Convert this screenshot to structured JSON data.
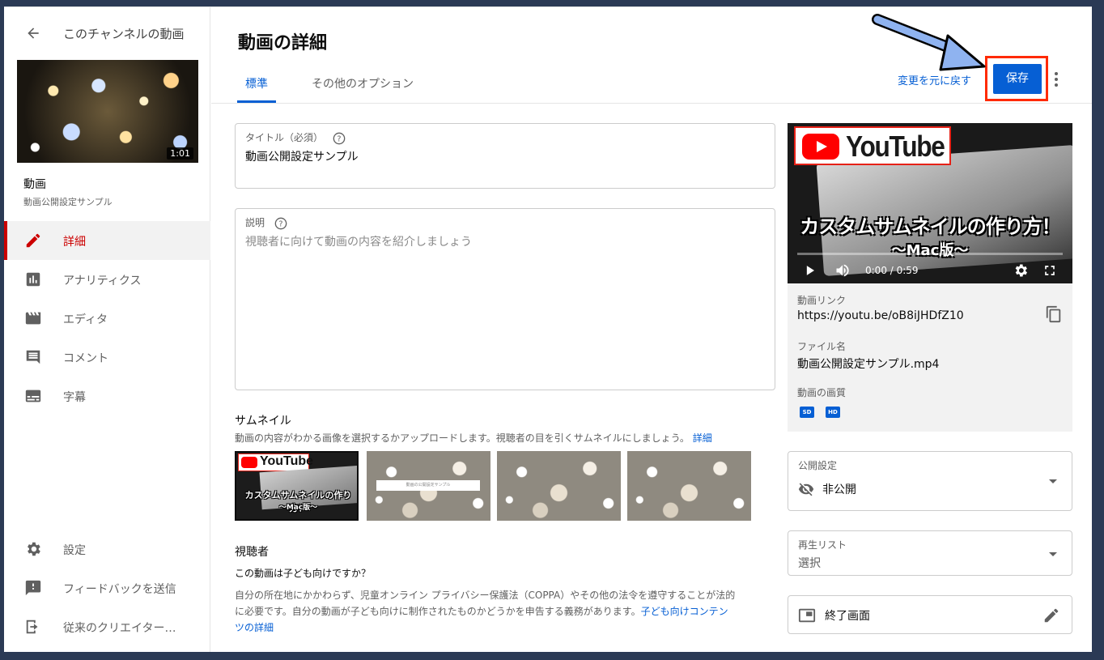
{
  "sidebar": {
    "back_title": "このチャンネルの動画",
    "thumb_duration": "1:01",
    "video_label": "動画",
    "video_sub": "動画公開設定サンプル",
    "items": [
      {
        "label": "詳細",
        "icon": "pencil-icon",
        "active": true
      },
      {
        "label": "アナリティクス",
        "icon": "analytics-icon"
      },
      {
        "label": "エディタ",
        "icon": "clapper-icon"
      },
      {
        "label": "コメント",
        "icon": "comment-icon"
      },
      {
        "label": "字幕",
        "icon": "subtitles-icon"
      }
    ],
    "bottom_items": [
      {
        "label": "設定",
        "icon": "gear-icon"
      },
      {
        "label": "フィードバックを送信",
        "icon": "feedback-icon"
      },
      {
        "label": "従来のクリエイター…",
        "icon": "exit-icon"
      }
    ]
  },
  "header": {
    "title": "動画の詳細",
    "tabs": [
      {
        "label": "標準",
        "active": true
      },
      {
        "label": "その他のオプション"
      }
    ],
    "revert_label": "変更を元に戻す",
    "save_label": "保存"
  },
  "form": {
    "title_label": "タイトル（必須）",
    "title_value": "動画公開設定サンプル",
    "desc_label": "説明",
    "desc_placeholder": "視聴者に向けて動画の内容を紹介しましょう",
    "thumbnail_title": "サムネイル",
    "thumbnail_desc": "動画の内容がわかる画像を選択するかアップロードします。視聴者の目を引くサムネイルにしましょう。",
    "thumbnail_link": "詳細",
    "audience_title": "視聴者",
    "audience_question": "この動画は子ども向けですか？",
    "audience_desc_1": "自分の所在地にかかわらず、児童オンライン プライバシー保護法（COPPA）やその他の法令を遵守することが法的",
    "audience_desc_2": "に必要です。自分の動画が子ども向けに制作されたものかどうかを申告する義務があります。",
    "audience_link_1": "子ども向けコンテン",
    "audience_link_2": "ツの詳細",
    "mini_thumb_caption": "動画の公開設定サンプル"
  },
  "preview": {
    "logo_text": "YouTube",
    "caption_line1": "カスタムサムネイルの作り方！",
    "caption_line2": "〜Mac版〜",
    "time": "0:00 / 0:59",
    "link_label": "動画リンク",
    "link_value": "https://youtu.be/oB8iJHDfZ10",
    "file_label": "ファイル名",
    "file_value": "動画公開設定サンプル.mp4",
    "quality_label": "動画の画質",
    "quality_badges": [
      "SD",
      "HD"
    ]
  },
  "visibility": {
    "label": "公開設定",
    "value": "非公開"
  },
  "playlist": {
    "label": "再生リスト",
    "value": "選択"
  },
  "end_screen": {
    "label": "終了画面"
  },
  "colors": {
    "accent": "#065fd4",
    "active_red": "#cc0000",
    "annotation_red": "#ff2a00",
    "annotation_arrow": "#8fb3f0"
  }
}
